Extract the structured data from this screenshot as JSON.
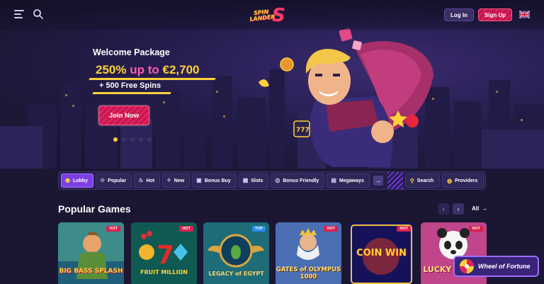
{
  "header": {
    "logo_top": "SPIN",
    "logo_bottom": "LANDER",
    "logo_mark": "S",
    "login_label": "Log In",
    "signup_label": "Sign Up",
    "language_flag": "uk-flag-icon"
  },
  "hero": {
    "welcome": "Welcome Package",
    "bonus_percent": "250%",
    "bonus_up_to": "up to",
    "bonus_amount": "€2,700",
    "free_spins": "+ 500 Free Spins",
    "cta_label": "Join Now",
    "slide_count": 5,
    "active_slide": 1
  },
  "category_nav": {
    "items": [
      {
        "label": "Lobby",
        "icon": "lobby-icon",
        "active": true
      },
      {
        "label": "Popular",
        "icon": "star-icon",
        "active": false
      },
      {
        "label": "Hot",
        "icon": "flame-icon",
        "active": false
      },
      {
        "label": "New",
        "icon": "sparkle-icon",
        "active": false
      },
      {
        "label": "Bonus Buy",
        "icon": "gift-icon",
        "active": false
      },
      {
        "label": "Slots",
        "icon": "slots-icon",
        "active": false
      },
      {
        "label": "Bonus Friendly",
        "icon": "bonus-icon",
        "active": false
      },
      {
        "label": "Megaways",
        "icon": "megaways-icon",
        "active": false
      }
    ],
    "search_label": "Search",
    "providers_label": "Providers"
  },
  "popular": {
    "title": "Popular Games",
    "all_label": "All",
    "games": [
      {
        "name": "BIG BASS SPLASH",
        "tag": "HOT"
      },
      {
        "name": "FRUIT MILLION",
        "tag": "HOT"
      },
      {
        "name": "LEGACY of EGYPT",
        "tag": "TOP"
      },
      {
        "name": "GATES of OLYMPUS 1000",
        "tag": "HOT"
      },
      {
        "name": "COIN WIN",
        "tag": "HOT"
      },
      {
        "name": "LUCKY PANDA",
        "tag": "HOT"
      }
    ]
  },
  "widget": {
    "wheel_label": "Wheel of Fortune"
  },
  "colors": {
    "background": "#1b1733",
    "accent_pink": "#d81f5a",
    "accent_gold": "#ffd23a",
    "accent_purple": "#7b3fe4"
  }
}
